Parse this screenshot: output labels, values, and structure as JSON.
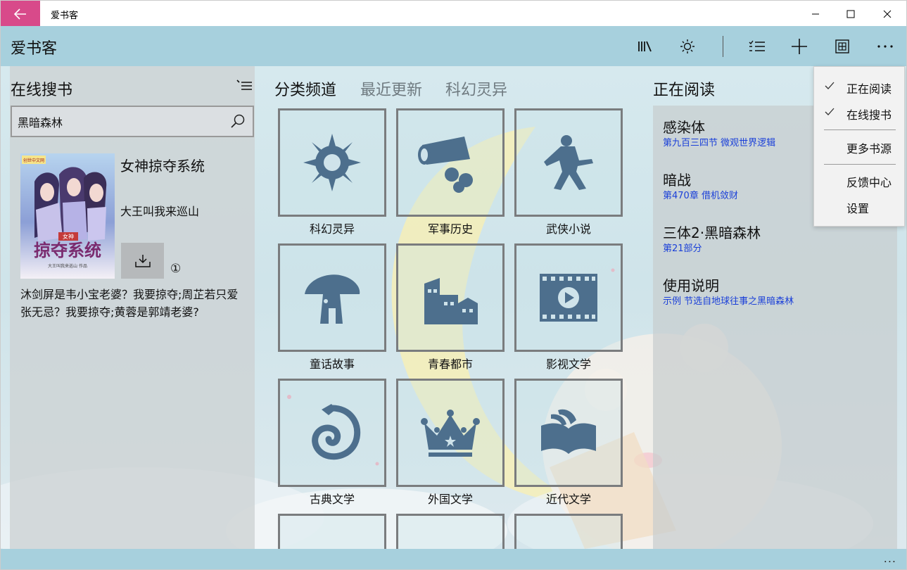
{
  "window": {
    "title": "爱书客",
    "accent": "#d84a8a"
  },
  "appbar": {
    "title": "爱书客",
    "background": "#a7d0dd",
    "toolbar_icons": [
      "library-icon",
      "brightness-icon",
      "checklist-icon",
      "add-icon",
      "grid-view-icon",
      "more-icon"
    ]
  },
  "search_panel": {
    "title": "在线搜书",
    "search_value": "黑暗森林",
    "result": {
      "cover": {
        "badge": "创世中文网",
        "small_title": "女神",
        "big_title": "掠夺系统",
        "footer": "大王叫我来巡山 作品"
      },
      "title": "女神掠夺系统",
      "author": "大王叫我来巡山",
      "download_count": "①",
      "description": "沐剑屏是韦小宝老婆？我要掠夺;周芷若只爱张无忌？我要掠夺;黄蓉是郭靖老婆?"
    }
  },
  "category_panel": {
    "tabs": [
      "分类频道",
      "最近更新",
      "科幻灵异"
    ],
    "active_tab": "分类频道",
    "categories": [
      {
        "label": "科幻灵异",
        "icon": "sci-fi-icon"
      },
      {
        "label": "军事历史",
        "icon": "cannon-icon"
      },
      {
        "label": "武侠小说",
        "icon": "martial-arts-icon"
      },
      {
        "label": "童话故事",
        "icon": "mushroom-house-icon"
      },
      {
        "label": "青春都市",
        "icon": "city-icon"
      },
      {
        "label": "影视文学",
        "icon": "film-icon"
      },
      {
        "label": "古典文学",
        "icon": "dragon-icon"
      },
      {
        "label": "外国文学",
        "icon": "crown-icon"
      },
      {
        "label": "近代文学",
        "icon": "open-book-icon"
      }
    ]
  },
  "reading_panel": {
    "title": "正在阅读",
    "books": [
      {
        "title": "感染体",
        "progress": "第九百三四节 微观世界逻辑"
      },
      {
        "title": "暗战",
        "progress": "第470章 借机敛财"
      },
      {
        "title": "三体2·黑暗森林",
        "progress": "第21部分"
      },
      {
        "title": "使用说明",
        "progress": "示例 节选自地球往事之黑暗森林"
      }
    ],
    "link_color": "#1a3fd8"
  },
  "menu": {
    "items": [
      {
        "label": "正在阅读",
        "checked": true
      },
      {
        "label": "在线搜书",
        "checked": true
      },
      {
        "label": "更多书源",
        "checked": false
      },
      {
        "label": "反馈中心",
        "checked": false
      },
      {
        "label": "设置",
        "checked": false
      }
    ]
  },
  "bottombar": {
    "more": "..."
  }
}
